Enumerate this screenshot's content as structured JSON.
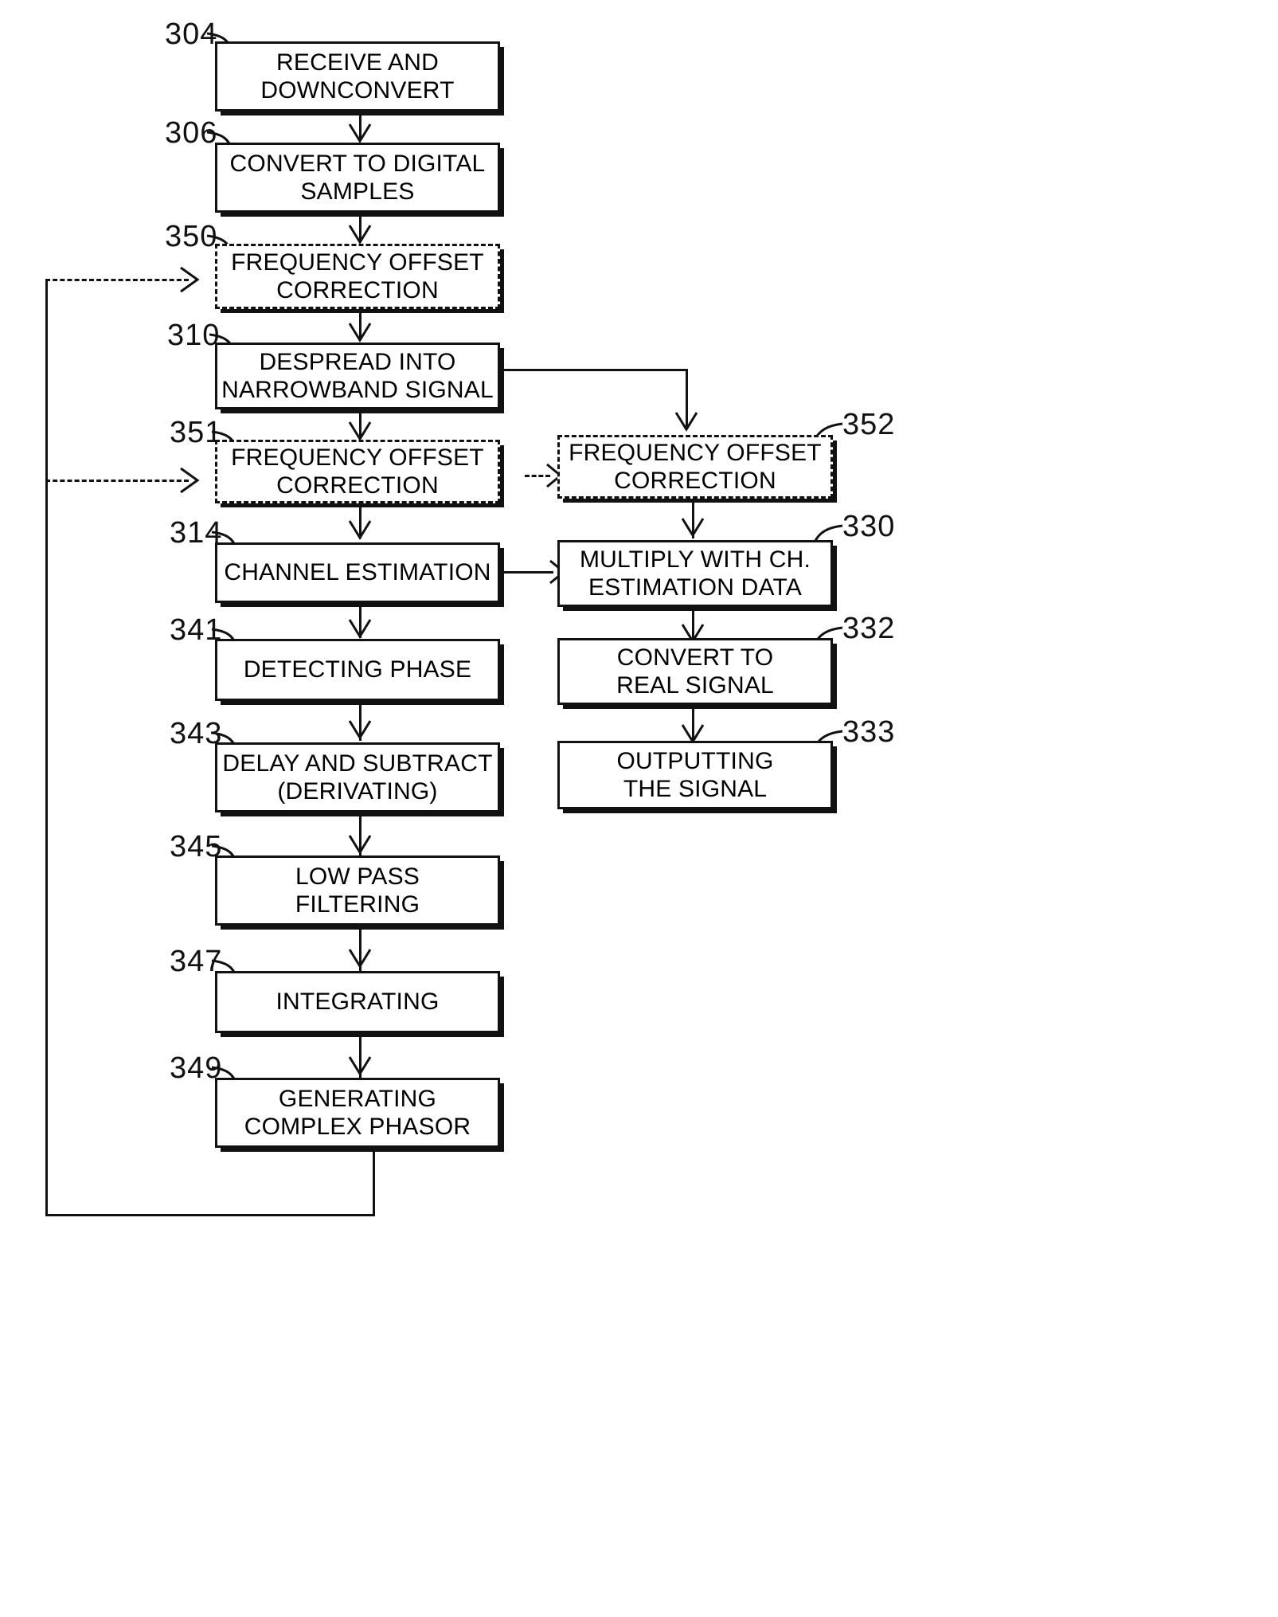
{
  "figure": {
    "type": "patent-flowchart",
    "orientation": "portrait"
  },
  "nodes": [
    {
      "id": "n304",
      "ref": "304",
      "lines": [
        "RECEIVE AND",
        "DOWNCONVERT"
      ],
      "style": "solid"
    },
    {
      "id": "n306",
      "ref": "306",
      "lines": [
        "CONVERT TO DIGITAL",
        "SAMPLES"
      ],
      "style": "solid"
    },
    {
      "id": "n350",
      "ref": "350",
      "lines": [
        "FREQUENCY OFFSET",
        "CORRECTION"
      ],
      "style": "dashed"
    },
    {
      "id": "n310",
      "ref": "310",
      "lines": [
        "DESPREAD INTO",
        "NARROWBAND SIGNAL"
      ],
      "style": "solid"
    },
    {
      "id": "n351",
      "ref": "351",
      "lines": [
        "FREQUENCY OFFSET",
        "CORRECTION"
      ],
      "style": "dashed"
    },
    {
      "id": "n352",
      "ref": "352",
      "lines": [
        "FREQUENCY OFFSET",
        "CORRECTION"
      ],
      "style": "dashed"
    },
    {
      "id": "n314",
      "ref": "314",
      "lines": [
        "CHANNEL ESTIMATION"
      ],
      "style": "solid"
    },
    {
      "id": "n330",
      "ref": "330",
      "lines": [
        "MULTIPLY WITH CH.",
        "ESTIMATION DATA"
      ],
      "style": "solid"
    },
    {
      "id": "n341",
      "ref": "341",
      "lines": [
        "DETECTING PHASE"
      ],
      "style": "solid"
    },
    {
      "id": "n332",
      "ref": "332",
      "lines": [
        "CONVERT TO",
        "REAL SIGNAL"
      ],
      "style": "solid"
    },
    {
      "id": "n343",
      "ref": "343",
      "lines": [
        "DELAY AND SUBTRACT",
        "(DERIVATING)"
      ],
      "style": "solid"
    },
    {
      "id": "n333",
      "ref": "333",
      "lines": [
        "OUTPUTTING",
        "THE SIGNAL"
      ],
      "style": "solid"
    },
    {
      "id": "n345",
      "ref": "345",
      "lines": [
        "LOW PASS",
        "FILTERING"
      ],
      "style": "solid"
    },
    {
      "id": "n347",
      "ref": "347",
      "lines": [
        "INTEGRATING"
      ],
      "style": "solid"
    },
    {
      "id": "n349",
      "ref": "349",
      "lines": [
        "GENERATING",
        "COMPLEX PHASOR"
      ],
      "style": "solid"
    }
  ],
  "edges": [
    {
      "from": "n304",
      "to": "n306",
      "kind": "solid-arrow"
    },
    {
      "from": "n306",
      "to": "n350",
      "kind": "solid-arrow"
    },
    {
      "from": "n350",
      "to": "n310",
      "kind": "solid-arrow"
    },
    {
      "from": "n310",
      "to": "n351",
      "kind": "solid-arrow"
    },
    {
      "from": "n310",
      "to": "n352",
      "kind": "solid-arrow"
    },
    {
      "from": "n351",
      "to": "n314",
      "kind": "solid-arrow"
    },
    {
      "from": "n351",
      "to": "n352",
      "kind": "dashed-arrow"
    },
    {
      "from": "n352",
      "to": "n330",
      "kind": "solid-arrow"
    },
    {
      "from": "n314",
      "to": "n330",
      "kind": "solid-arrow"
    },
    {
      "from": "n314",
      "to": "n341",
      "kind": "solid-arrow"
    },
    {
      "from": "n330",
      "to": "n332",
      "kind": "solid-arrow"
    },
    {
      "from": "n332",
      "to": "n333",
      "kind": "solid-arrow"
    },
    {
      "from": "n341",
      "to": "n343",
      "kind": "solid-arrow"
    },
    {
      "from": "n343",
      "to": "n345",
      "kind": "solid-arrow"
    },
    {
      "from": "n345",
      "to": "n347",
      "kind": "solid-arrow"
    },
    {
      "from": "n347",
      "to": "n349",
      "kind": "solid-arrow"
    },
    {
      "from": "n349",
      "to": "n350",
      "kind": "feedback-dashed-arrow"
    },
    {
      "from": "n349",
      "to": "n351",
      "kind": "feedback-dashed-arrow"
    }
  ],
  "colors": {
    "stroke": "#111111",
    "background": "#ffffff"
  }
}
